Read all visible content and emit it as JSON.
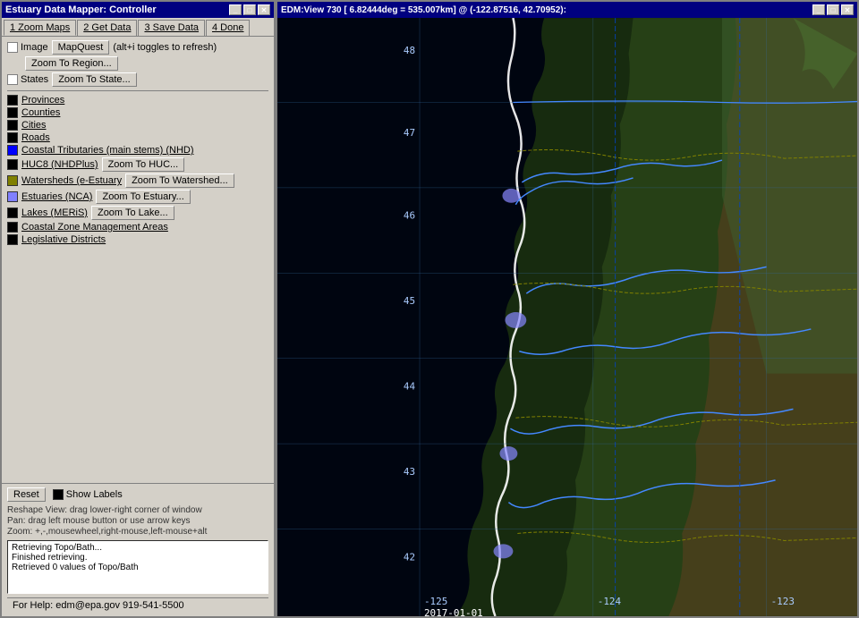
{
  "controller": {
    "title": "Estuary Data Mapper: Controller",
    "tabs": [
      {
        "id": "zoom-maps",
        "label": "1  Zoom Maps"
      },
      {
        "id": "get-data",
        "label": "2  Get Data"
      },
      {
        "id": "save-data",
        "label": "3  Save Data"
      },
      {
        "id": "done",
        "label": "4 Done"
      }
    ],
    "image_checkbox": false,
    "mapquest_button": "MapQuest",
    "mapquest_hint": "(alt+i toggles to refresh)",
    "zoom_region_button": "Zoom To Region...",
    "states_checkbox": false,
    "zoom_state_button": "Zoom To State...",
    "layers": [
      {
        "id": "provinces",
        "label": "Provinces",
        "color": "#000000",
        "has_zoom": false
      },
      {
        "id": "counties",
        "label": "Counties",
        "color": "#000000",
        "has_zoom": false
      },
      {
        "id": "cities",
        "label": "Cities",
        "color": "#000000",
        "has_zoom": false
      },
      {
        "id": "roads",
        "label": "Roads",
        "color": "#000000",
        "has_zoom": false
      },
      {
        "id": "coastal-tributaries",
        "label": "Coastal Tributaries (main stems) (NHD)",
        "color": "#0000ff",
        "has_zoom": false
      },
      {
        "id": "huc8",
        "label": "HUC8 (NHDPlus)",
        "color": "#000000",
        "has_zoom": true,
        "zoom_label": "Zoom To HUC..."
      },
      {
        "id": "watersheds",
        "label": "Watersheds (e-Estuary",
        "color": "#808000",
        "has_zoom": true,
        "zoom_label": "Zoom To Watershed..."
      },
      {
        "id": "estuaries",
        "label": "Estuaries (NCA)",
        "color": "#8080ff",
        "has_zoom": true,
        "zoom_label": "Zoom To Estuary..."
      },
      {
        "id": "lakes",
        "label": "Lakes (MERiS)",
        "color": "#000000",
        "has_zoom": true,
        "zoom_label": "Zoom To Lake..."
      },
      {
        "id": "coastal-zone",
        "label": "Coastal Zone Management Areas",
        "color": "#000000",
        "has_zoom": false
      },
      {
        "id": "legislative",
        "label": "Legislative Districts",
        "color": "#000000",
        "has_zoom": false
      }
    ],
    "reset_button": "Reset",
    "show_labels_checkbox": false,
    "show_labels_label": "Show Labels",
    "info_lines": [
      "Reshape View: drag lower-right corner of window",
      "Pan: drag left mouse button or use arrow keys",
      "Zoom: +,-,mousewheel,right-mouse,left-mouse+alt"
    ],
    "log_lines": [
      "Retrieving Topo/Bath...",
      "Finished retrieving.",
      "Retrieved 0 values of Topo/Bath"
    ],
    "status": "For Help: edm@epa.gov 919-541-5500"
  },
  "map": {
    "title": "EDM:View 730 [ 6.82444deg = 535.007km] @ (-122.87516, 42.70952):",
    "date_label": "2017-01-01",
    "lat_labels": [
      "48",
      "47",
      "46",
      "45",
      "44",
      "43",
      "42"
    ],
    "lon_labels": [
      "-125",
      "-124",
      "-123"
    ],
    "titlebar_buttons": [
      "_",
      "□",
      "✕"
    ]
  }
}
